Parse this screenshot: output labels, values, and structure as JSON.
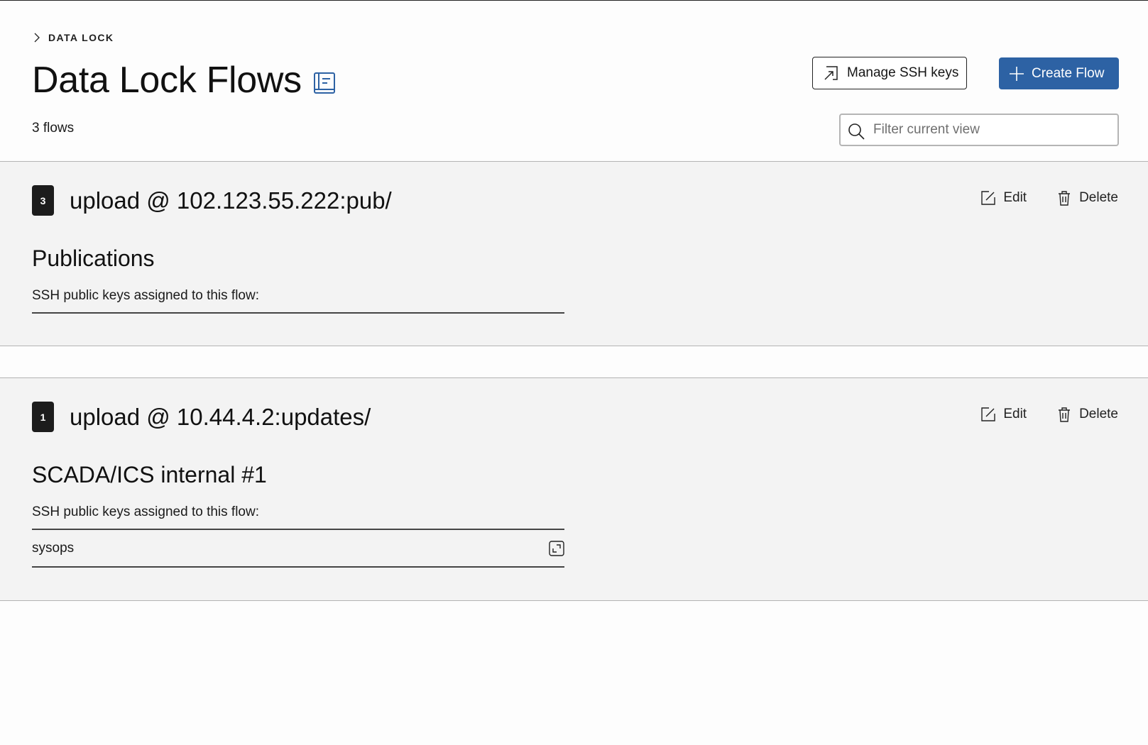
{
  "breadcrumb": {
    "icon": "chevron-right-icon",
    "label": "DATA LOCK"
  },
  "header": {
    "title": "Data Lock Flows",
    "title_icon": "documentation-icon",
    "count": "3 flows",
    "manage_button": {
      "label": "Manage SSH keys",
      "icon": "launch-icon"
    },
    "create_button": {
      "label": "Create Flow",
      "icon": "plus-icon"
    },
    "filter": {
      "placeholder": "Filter current view",
      "value": "",
      "icon": "search-icon"
    }
  },
  "colors": {
    "primary": "#2d62a4",
    "badge_bg": "#1c1c1c",
    "section_bg": "#f3f3f3"
  },
  "flows": [
    {
      "id_badge": "3",
      "title": "upload @ 102.123.55.222:pub/",
      "name": "Publications",
      "keys_label": "SSH public keys assigned to this flow:",
      "keys": [],
      "edit_label": "Edit",
      "delete_label": "Delete"
    },
    {
      "id_badge": "1",
      "title": "upload @ 10.44.4.2:updates/",
      "name": "SCADA/ICS internal #1",
      "keys_label": "SSH public keys assigned to this flow:",
      "keys": [
        {
          "name": "sysops",
          "icon": "minimize-icon"
        }
      ],
      "edit_label": "Edit",
      "delete_label": "Delete"
    }
  ]
}
